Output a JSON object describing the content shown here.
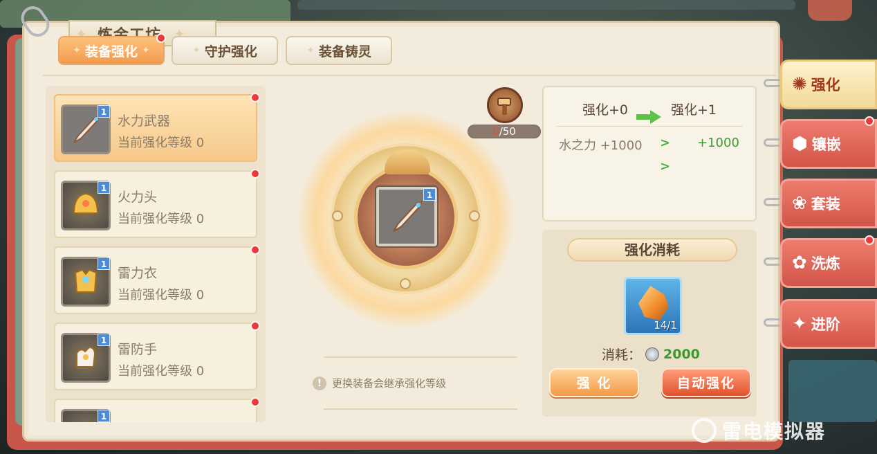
{
  "window": {
    "title": "炼金工坊"
  },
  "tabs": [
    {
      "label": "装备强化",
      "active": true,
      "badge": true
    },
    {
      "label": "守护强化",
      "active": false,
      "badge": false
    },
    {
      "label": "装备铸灵",
      "active": false,
      "badge": false
    }
  ],
  "equipment_list": [
    {
      "name": "水力武器",
      "level_text": "当前强化等级 0",
      "badge_num": "1",
      "icon": "sword-icon",
      "selected": true
    },
    {
      "name": "火力头",
      "level_text": "当前强化等级 0",
      "badge_num": "1",
      "icon": "helmet-icon",
      "selected": false
    },
    {
      "name": "雷力衣",
      "level_text": "当前强化等级 0",
      "badge_num": "1",
      "icon": "armor-icon",
      "selected": false
    },
    {
      "name": "雷防手",
      "level_text": "当前强化等级 0",
      "badge_num": "1",
      "icon": "glove-icon",
      "selected": false
    },
    {
      "name": "",
      "level_text": "",
      "badge_num": "1",
      "icon": "item-icon",
      "selected": false
    }
  ],
  "center": {
    "slot_badge": "1",
    "progress_current": "0",
    "progress_total": "/50",
    "tip": "更换装备会继承强化等级"
  },
  "stats": {
    "from_level": "强化+0",
    "to_level": "强化+1",
    "attr_name": "水之力 +1000",
    "attr_next": "+1000"
  },
  "cost": {
    "title": "强化消耗",
    "material_count": "14/1",
    "cost_label": "消耗：",
    "cost_amount": "2000",
    "btn_enhance": "强 化",
    "btn_auto": "自动强化"
  },
  "side_tabs": [
    {
      "label": "强化",
      "icon": "✺",
      "active": true,
      "badge": false
    },
    {
      "label": "镶嵌",
      "icon": "⬢",
      "active": false,
      "badge": true
    },
    {
      "label": "套装",
      "icon": "❀",
      "active": false,
      "badge": false
    },
    {
      "label": "洗炼",
      "icon": "✿",
      "active": false,
      "badge": true
    },
    {
      "label": "进阶",
      "icon": "✦",
      "active": false,
      "badge": false
    }
  ],
  "watermark": "雷电模拟器",
  "colors": {
    "accent": "#f29a4d",
    "side_tab": "#d25548",
    "cost_green": "#3e9a2f"
  }
}
